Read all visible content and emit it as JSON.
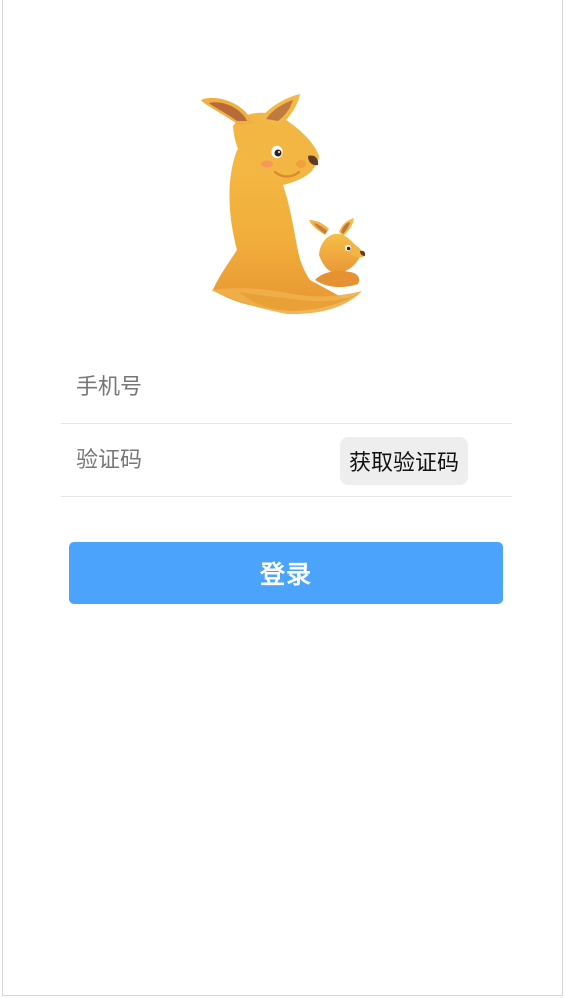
{
  "app": {
    "logo_icon": "kangaroo-logo-icon",
    "brand_color": "#f2b13f"
  },
  "form": {
    "phone": {
      "placeholder": "手机号",
      "value": ""
    },
    "code": {
      "placeholder": "验证码",
      "value": "",
      "get_code_label": "获取验证码"
    }
  },
  "actions": {
    "login_label": "登录",
    "login_color": "#4ba3fb"
  }
}
